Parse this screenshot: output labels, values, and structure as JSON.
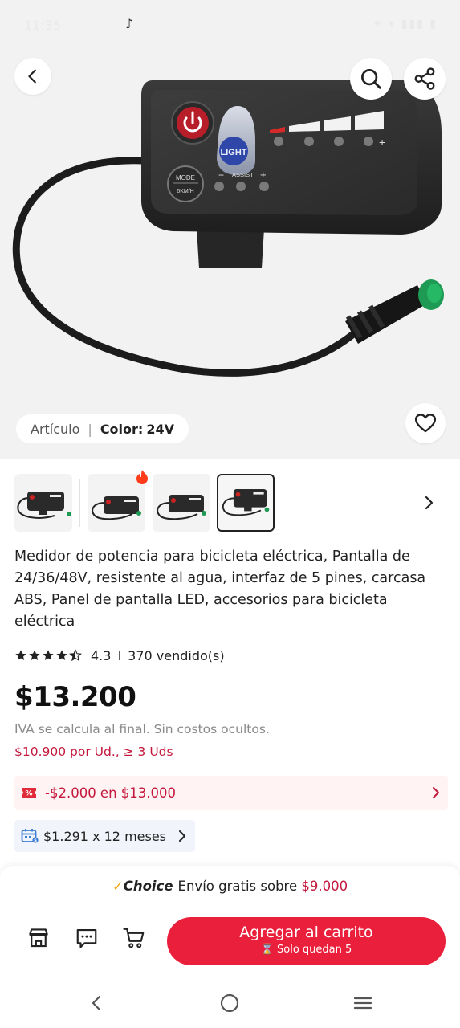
{
  "status_bar": {
    "time": "11:35",
    "right_icons": "✦ ▾ ▮▮▮ ▮"
  },
  "hero": {
    "variant_label": "Artículo",
    "color_label": "Color:",
    "color_value": "24V"
  },
  "product_image": {
    "light_label": "LIGHT",
    "mode_label": "MODE",
    "kmh_label": "6KM/H",
    "assist_label": "ASSIST"
  },
  "thumbnails": {
    "count": 4,
    "selected_index": 3
  },
  "product": {
    "title": "Medidor de potencia para bicicleta eléctrica, Pantalla de 24/36/48V, resistente al agua, interfaz de 5 pines, carcasa ABS, Panel de pantalla LED, accesorios para bicicleta eléctrica",
    "rating": "4.3",
    "rating_stars": 4.3,
    "sold": "370 vendido(s)",
    "price": "$13.200",
    "tax_note": "IVA se calcula al final. Sin costos ocultos.",
    "bulk_price": "$10.900 por Ud., ≥ 3 Uds"
  },
  "coupon": {
    "text": "-$2.000 en $13.000"
  },
  "installments": {
    "text": "$1.291 x 12 meses"
  },
  "shipping": {
    "check": "✓",
    "brand": "Choice",
    "text": "Envío gratis sobre",
    "amount": "$9.000"
  },
  "actions": {
    "add_to_cart": "Agregar al carrito",
    "stock_note": "Solo quedan 5"
  },
  "colors": {
    "accent_red": "#ea1f3b",
    "price_red": "#c4183c",
    "choice_gold": "#f3a50a"
  }
}
